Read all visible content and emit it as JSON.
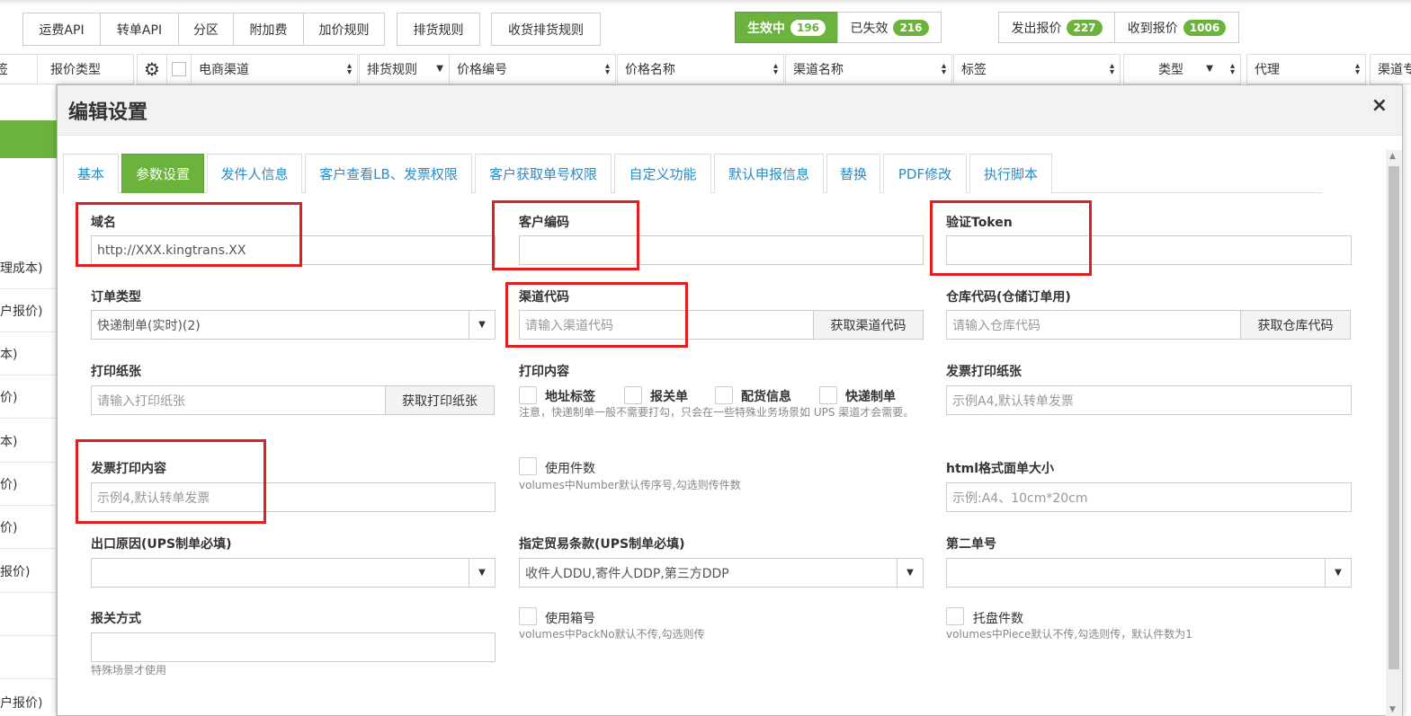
{
  "toolbar": {
    "buttons": [
      "运费API",
      "转单API",
      "分区",
      "附加费",
      "加价规则"
    ],
    "rules_btn": "排货规则",
    "receive_rules_btn": "收货排货规则",
    "active": {
      "label": "生效中",
      "count": "196"
    },
    "expired": {
      "label": "已失效",
      "count": "216"
    },
    "sent": {
      "label": "发出报价",
      "count": "227"
    },
    "received": {
      "label": "收到报价",
      "count": "1006"
    }
  },
  "table_header": {
    "left_tabs": [
      "签",
      "报价类型"
    ],
    "columns": [
      "电商渠道",
      "排货规则",
      "价格编号",
      "价格名称",
      "渠道名称",
      "标签",
      "类型",
      "代理",
      "渠道专"
    ]
  },
  "sidebar": {
    "items": [
      "理成本)",
      "户报价)",
      "本)",
      "价)",
      "本)",
      "价)",
      "价)",
      "报价)",
      "",
      "",
      "户报价)"
    ]
  },
  "modal": {
    "title": "编辑设置",
    "close": "×",
    "tabs": [
      "基本",
      "参数设置",
      "发件人信息",
      "客户查看LB、发票权限",
      "客户获取单号权限",
      "自定义功能",
      "默认申报信息",
      "替换",
      "PDF修改",
      "执行脚本"
    ],
    "active_tab": "参数设置",
    "fields": {
      "domain": {
        "label": "域名",
        "value": "http://XXX.kingtrans.XX"
      },
      "customer_code": {
        "label": "客户编码",
        "value": ""
      },
      "token": {
        "label": "验证Token",
        "value": ""
      },
      "order_type": {
        "label": "订单类型",
        "value": "快递制单(实时)(2)"
      },
      "channel_code": {
        "label": "渠道代码",
        "placeholder": "请输入渠道代码",
        "button": "获取渠道代码"
      },
      "warehouse_code": {
        "label": "仓库代码(仓储订单用)",
        "placeholder": "请输入仓库代码",
        "button": "获取仓库代码"
      },
      "print_paper": {
        "label": "打印纸张",
        "placeholder": "请输入打印纸张",
        "button": "获取打印纸张"
      },
      "print_content": {
        "label": "打印内容",
        "options": [
          "地址标签",
          "报关单",
          "配货信息",
          "快递制单"
        ],
        "hint": "注意，快递制单一般不需要打勾，只会在一些特殊业务场景如 UPS 渠道才会需要。"
      },
      "invoice_paper": {
        "label": "发票打印纸张",
        "placeholder": "示例A4,默认转单发票"
      },
      "invoice_content": {
        "label": "发票打印内容",
        "placeholder": "示例4,默认转单发票"
      },
      "use_pieces": {
        "label": "使用件数",
        "hint": "volumes中Number默认传序号,勾选则传件数"
      },
      "html_size": {
        "label": "html格式面单大小",
        "placeholder": "示例:A4、10cm*20cm"
      },
      "export_reason": {
        "label": "出口原因(UPS制单必填)",
        "value": ""
      },
      "trade_terms": {
        "label": "指定贸易条款(UPS制单必填)",
        "value": "收件人DDU,寄件人DDP,第三方DDP"
      },
      "second_no": {
        "label": "第二单号",
        "value": ""
      },
      "customs_method": {
        "label": "报关方式",
        "value": "",
        "hint": "特殊场景才使用"
      },
      "use_box_no": {
        "label": "使用箱号",
        "hint": "volumes中PackNo默认不传,勾选则传"
      },
      "pallet_count": {
        "label": "托盘件数",
        "hint": "volumes中Piece默认不传,勾选则传，默认件数为1"
      }
    }
  }
}
